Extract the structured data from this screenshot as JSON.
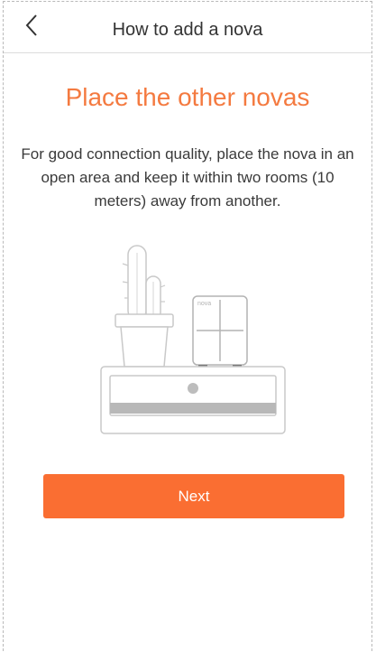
{
  "header": {
    "title": "How to add a nova",
    "back_icon": "chevron-left-icon"
  },
  "main": {
    "heading": "Place the other novas",
    "description": "For good connection quality, place the nova in an open area and keep it within two rooms (10 meters) away from another.",
    "illustration": {
      "device_label": "nova"
    },
    "next_label": "Next"
  },
  "colors": {
    "accent": "#f47a40",
    "button": "#fa6e32",
    "button_text": "#ffffff",
    "text": "#333333"
  }
}
